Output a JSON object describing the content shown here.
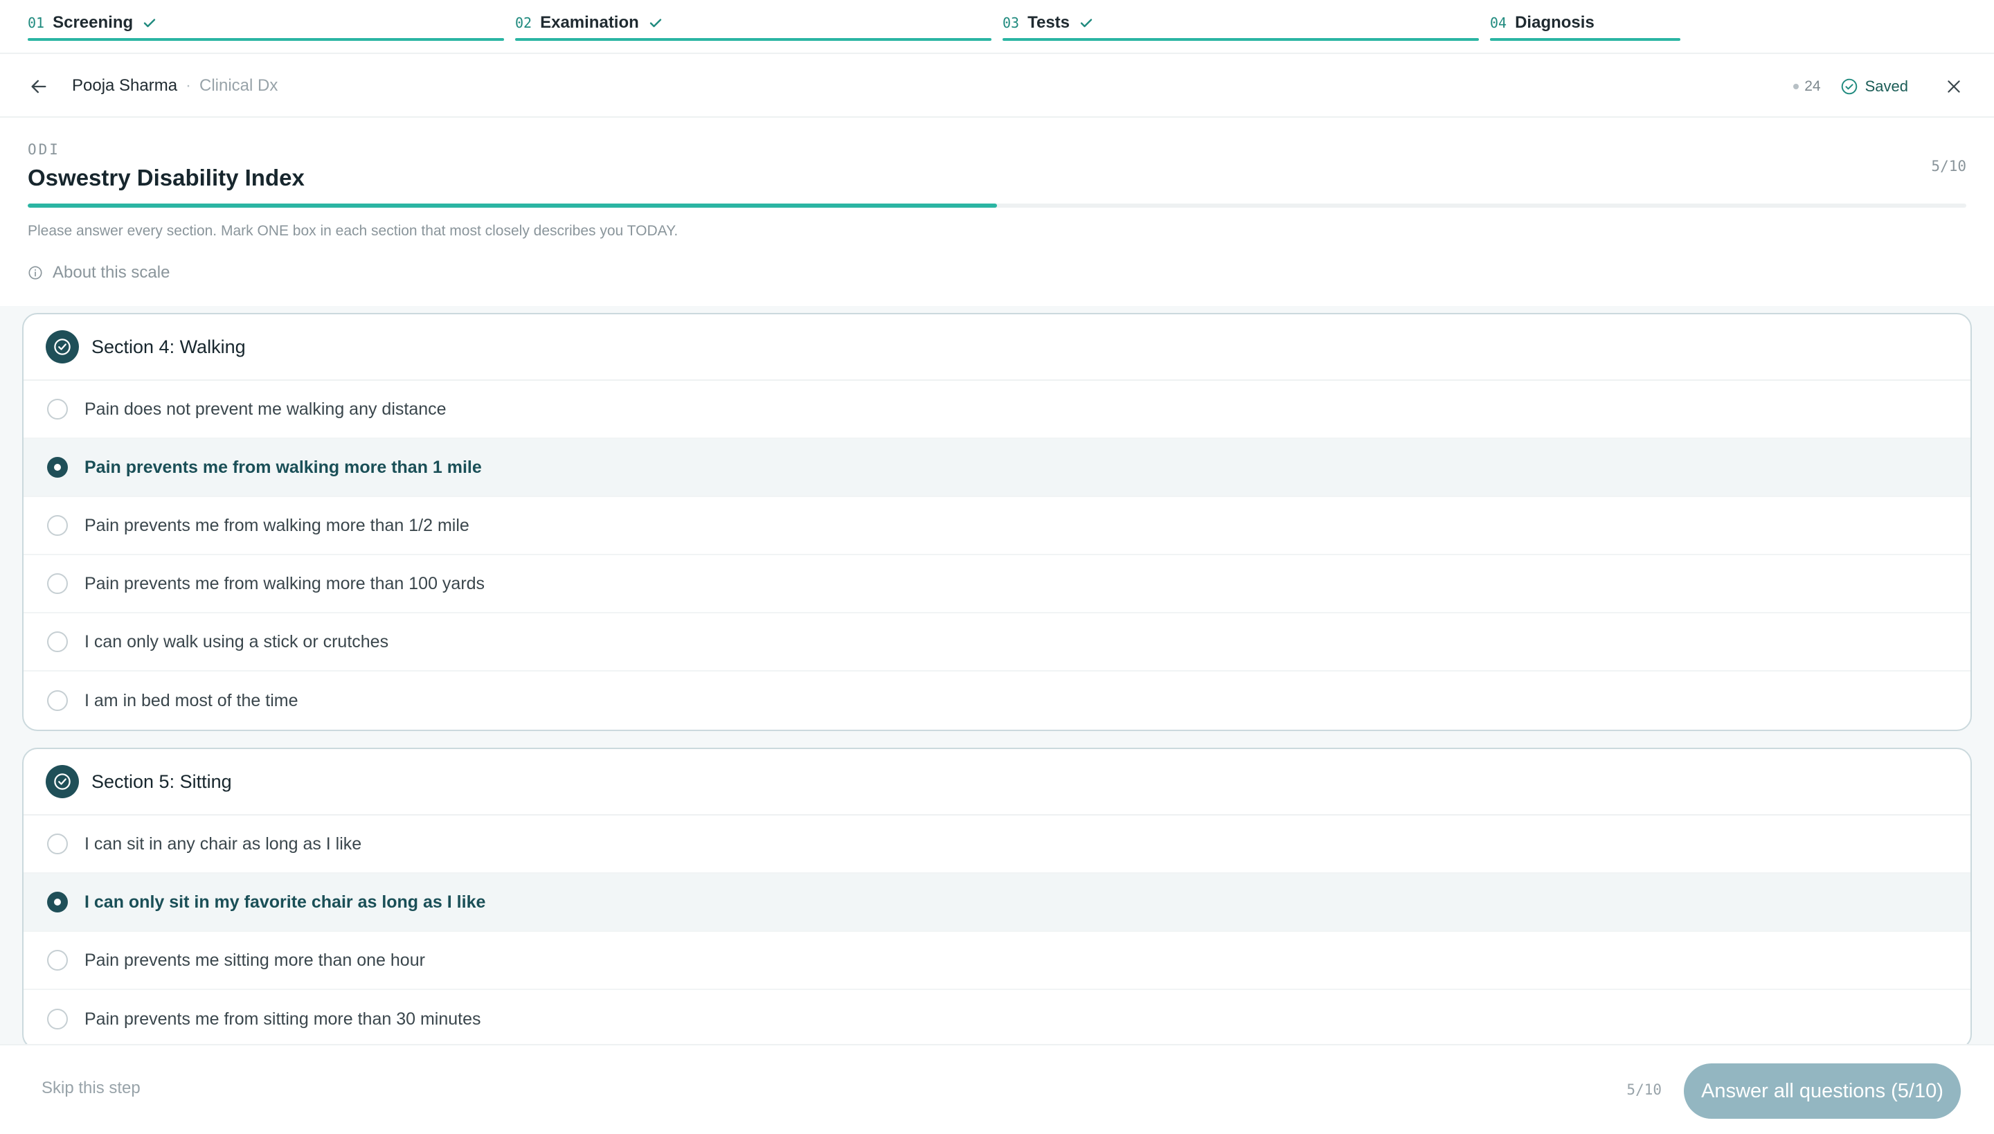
{
  "stepper": {
    "steps": [
      {
        "num": "01",
        "label": "Screening",
        "done": true
      },
      {
        "num": "02",
        "label": "Examination",
        "done": true
      },
      {
        "num": "03",
        "label": "Tests",
        "done": true
      },
      {
        "num": "04",
        "label": "Diagnosis",
        "done": false,
        "progress": 0.4
      }
    ]
  },
  "header": {
    "patient_name": "Pooja Sharma",
    "separator": "·",
    "context": "Clinical Dx",
    "count": "24",
    "saved_label": "Saved"
  },
  "scale": {
    "code": "ODI",
    "title": "Oswestry Disability Index",
    "progress_text": "5/10",
    "progress": 0.5,
    "instructions": "Please answer every section. Mark ONE box in each section that most closely describes you TODAY.",
    "about_label": "About this scale"
  },
  "sections": [
    {
      "title": "Section 4: Walking",
      "selected": 1,
      "options": [
        "Pain does not prevent me walking any distance",
        "Pain prevents me from walking more than 1 mile",
        "Pain prevents me from walking more than 1/2 mile",
        "Pain prevents me from walking more than 100 yards",
        "I can only walk using a stick or crutches",
        "I am in bed most of the time"
      ]
    },
    {
      "title": "Section 5: Sitting",
      "selected": 1,
      "options": [
        "I can sit in any chair as long as I like",
        "I can only sit in my favorite chair as long as I like",
        "Pain prevents me sitting more than one hour",
        "Pain prevents me from sitting more than 30 minutes"
      ]
    }
  ],
  "footer": {
    "skip_label": "Skip this step",
    "count": "5/10",
    "submit_label": "Answer all questions (5/10)"
  },
  "colors": {
    "accent": "#2bb5a3",
    "primary_dark": "#1f4f58",
    "submit_disabled": "#93b6c1"
  }
}
